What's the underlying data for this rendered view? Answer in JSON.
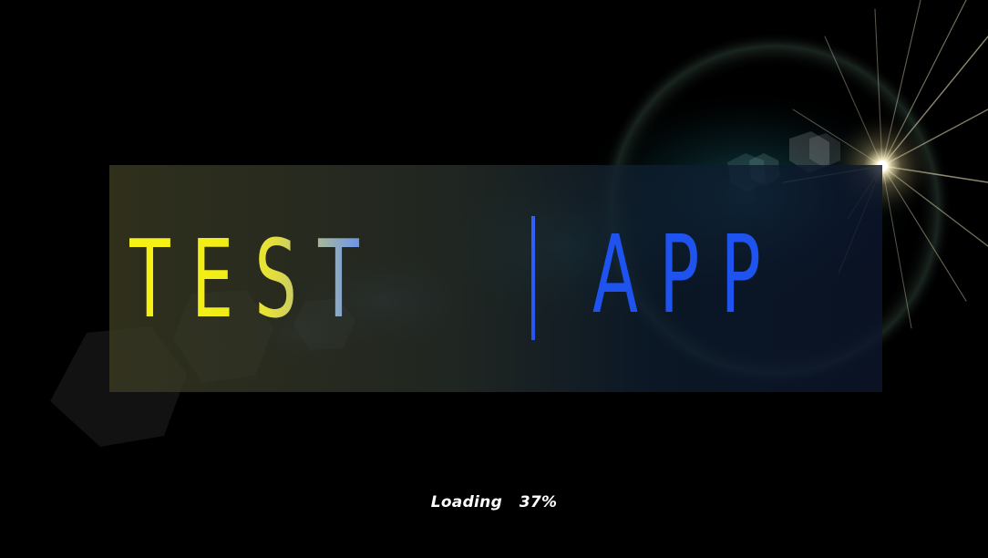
{
  "splash": {
    "title_left": "TEST",
    "title_right": "APP",
    "loading_label": "Loading",
    "loading_percent_text": "37%",
    "progress": 0.37
  },
  "colors": {
    "background": "#000000",
    "title_yellow": "#f1ef10",
    "title_blue": "#1f53f0",
    "loading_text": "#ffffff"
  },
  "icons": {
    "lens_flare": "lens-flare-icon"
  }
}
